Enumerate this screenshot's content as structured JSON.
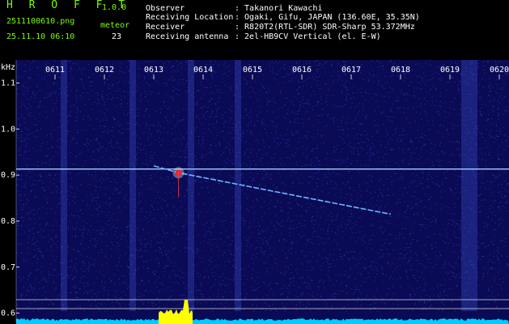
{
  "header": {
    "app_title": "H R O F F T",
    "app_version": "1.0.0",
    "file_name": "2511100610.png",
    "meteor_label": "meteor",
    "timestamp": "25.11.10 06:10",
    "meteor_count": "23"
  },
  "station_info": [
    {
      "key": "Observer",
      "value": ": Takanori Kawachi"
    },
    {
      "key": "Receiving Location",
      "value": ": Ogaki, Gifu, JAPAN (136.60E, 35.35N)"
    },
    {
      "key": "Receiver",
      "value": ": R820T2(RTL-SDR) SDR-Sharp 53.372MHz"
    },
    {
      "key": "Receiving antenna",
      "value": ": 2el-HB9CV Vertical (el. E-W)"
    }
  ],
  "chart_data": {
    "type": "heatmap",
    "ylabel": "kHz",
    "x_ticks": [
      "0611",
      "0612",
      "0613",
      "0614",
      "0615",
      "0616",
      "0617",
      "0618",
      "0619",
      "0620"
    ],
    "y_ticks": [
      1.1,
      1.0,
      0.9,
      0.8,
      0.7,
      0.6
    ],
    "ylim": [
      0.58,
      1.15
    ],
    "carrier_khz": 0.913,
    "meteor_trail": {
      "start_time": "0613.0",
      "start_khz": 0.92,
      "head_time": "0613.5",
      "head_khz": 0.905,
      "end_time": "0617.8",
      "end_khz": 0.815
    },
    "meteor_head_time": "0613.5",
    "colors": {
      "background": "#0a0a55",
      "noise": "#2a3aa8",
      "carrier": "#9fd0ff",
      "head": "#ff2020",
      "signal_level": "#ffff00",
      "noise_level": "#00ccff"
    }
  }
}
